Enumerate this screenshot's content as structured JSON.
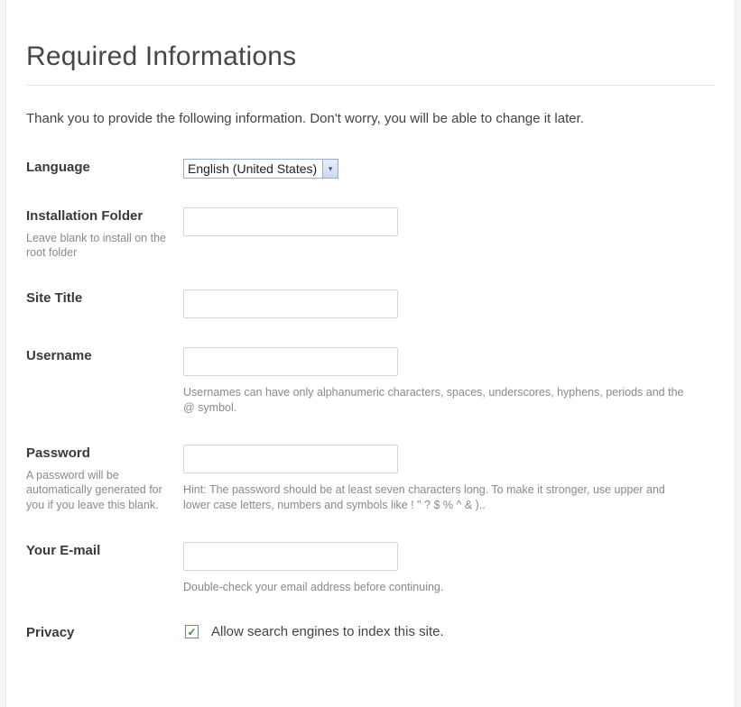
{
  "title": "Required Informations",
  "intro": "Thank you to provide the following information. Don't worry, you will be able to change it later.",
  "fields": {
    "language": {
      "label": "Language",
      "selected": "English (United States)"
    },
    "installFolder": {
      "label": "Installation Folder",
      "hint": "Leave blank to install on the root folder",
      "value": ""
    },
    "siteTitle": {
      "label": "Site Title",
      "value": ""
    },
    "username": {
      "label": "Username",
      "value": "",
      "fieldHint": "Usernames can have only alphanumeric characters, spaces, underscores, hyphens, periods and the @ symbol."
    },
    "password": {
      "label": "Password",
      "hint": "A password will be automatically generated for you if you leave this blank.",
      "value": "",
      "fieldHint": "Hint: The password should be at least seven characters long. To make it stronger, use upper and lower case letters, numbers and symbols like ! \" ? $ % ^ & ).."
    },
    "email": {
      "label": "Your E-mail",
      "value": "",
      "fieldHint": "Double-check your email address before continuing."
    },
    "privacy": {
      "label": "Privacy",
      "checkboxLabel": "Allow search engines to index this site.",
      "checked": true
    }
  }
}
